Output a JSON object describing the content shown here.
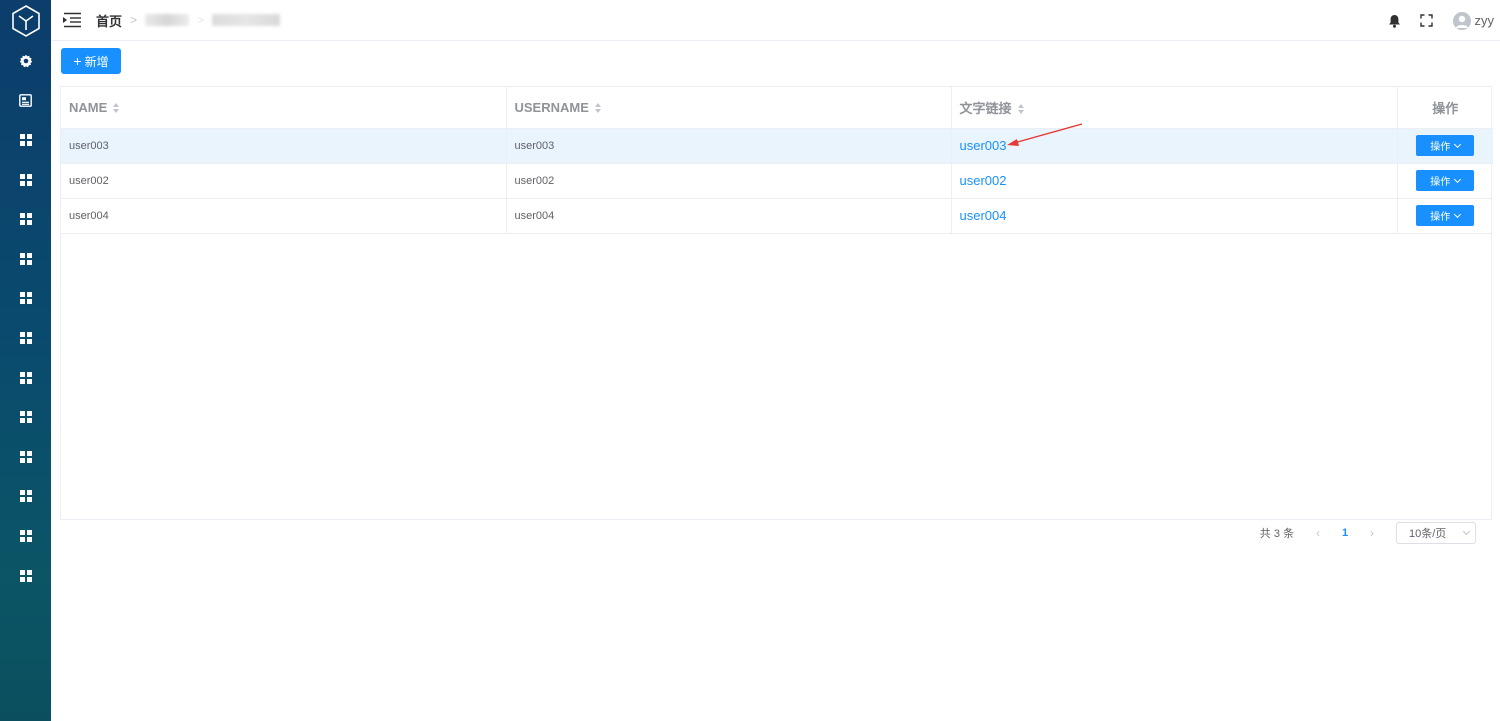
{
  "breadcrumb": {
    "home": "首页"
  },
  "user": {
    "name": "zyy"
  },
  "toolbar": {
    "add_label": "新增"
  },
  "table": {
    "columns": [
      "NAME",
      "USERNAME",
      "文字链接",
      "操作"
    ],
    "rows": [
      {
        "name": "user003",
        "username": "user003",
        "link": "user003",
        "action": "操作"
      },
      {
        "name": "user002",
        "username": "user002",
        "link": "user002",
        "action": "操作"
      },
      {
        "name": "user004",
        "username": "user004",
        "link": "user004",
        "action": "操作"
      }
    ]
  },
  "pagination": {
    "total": "共 3 条",
    "current": "1",
    "page_size": "10条/页"
  },
  "colors": {
    "primary": "#1890ff",
    "sidebar": "#0c3d6b",
    "row_highlight": "#eaf4fd",
    "annotation_arrow": "#e53935"
  },
  "sidebar": {
    "items": [
      "settings-icon",
      "report-icon",
      "grid-icon",
      "grid-icon",
      "grid-icon",
      "grid-icon",
      "grid-icon",
      "grid-icon",
      "grid-icon",
      "grid-icon",
      "grid-icon",
      "grid-icon",
      "grid-icon",
      "grid-icon"
    ]
  }
}
